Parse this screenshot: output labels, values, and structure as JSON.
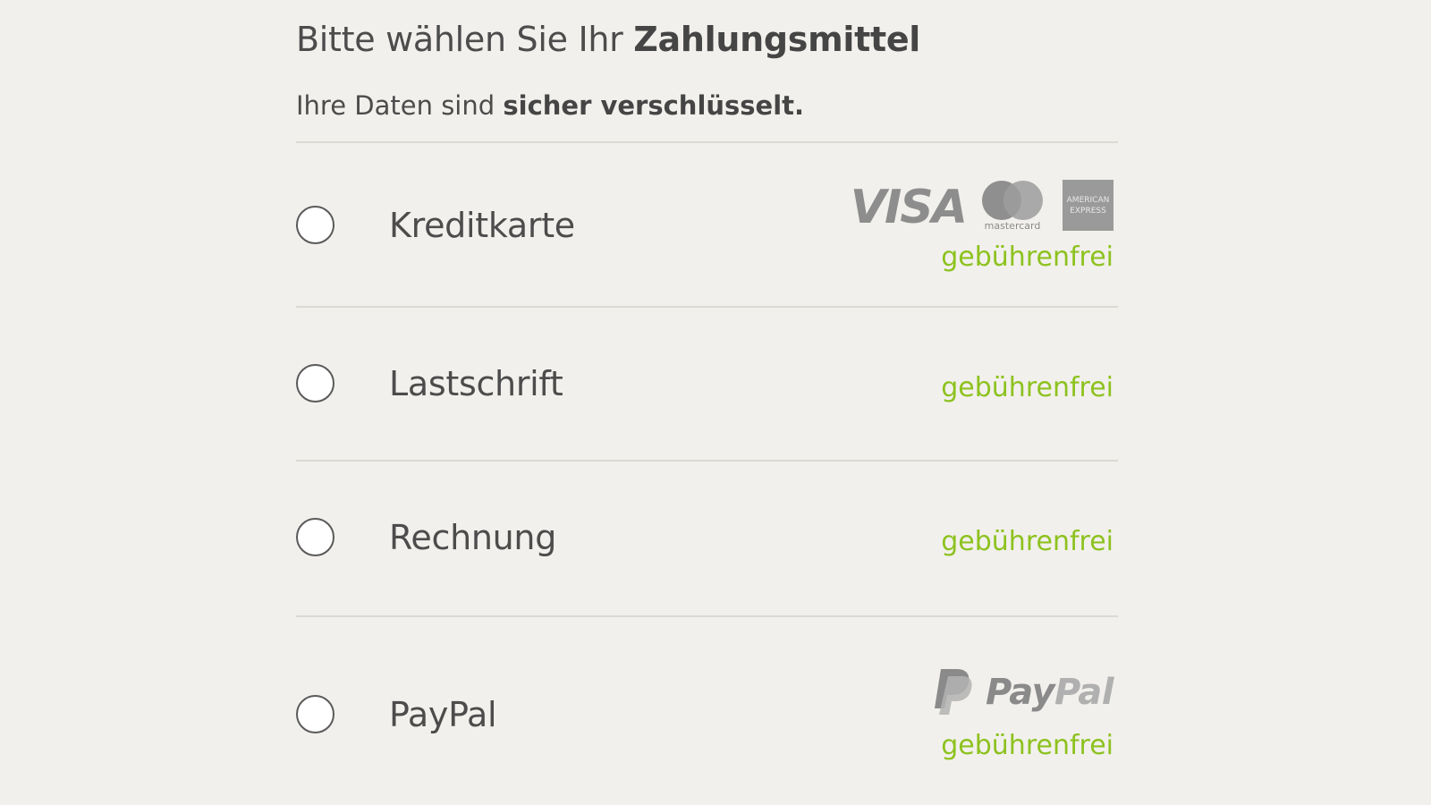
{
  "header": {
    "title_prefix": "Bitte wählen Sie Ihr ",
    "title_emphasis": "Zahlungsmittel",
    "security_prefix": "Ihre Daten sind ",
    "security_emphasis": "sicher verschlüsselt."
  },
  "payment_options": [
    {
      "label": "Kreditkarte",
      "fee": "gebührenfrei",
      "selected": false,
      "logos": {
        "visa": "VISA",
        "mastercard": "mastercard",
        "amex_line1": "AMERICAN",
        "amex_line2": "EXPRESS"
      }
    },
    {
      "label": "Lastschrift",
      "fee": "gebührenfrei",
      "selected": false
    },
    {
      "label": "Rechnung",
      "fee": "gebührenfrei",
      "selected": false
    },
    {
      "label": "PayPal",
      "fee": "gebührenfrei",
      "selected": false,
      "logos": {
        "paypal_pay": "Pay",
        "paypal_pal": "Pal"
      }
    }
  ],
  "colors": {
    "background": "#f2f0ec",
    "text": "#4c4c4c",
    "fee_green": "#8dc21f",
    "divider": "#dcd9d4",
    "logo_gray": "#8d8d8d"
  }
}
